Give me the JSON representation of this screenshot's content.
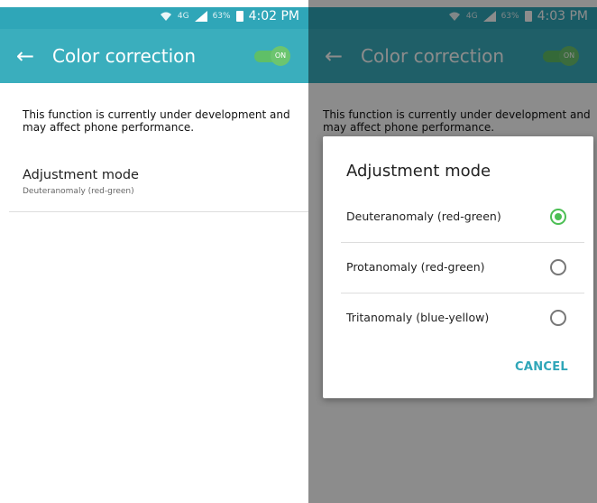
{
  "left": {
    "status": {
      "wifi_label": "4G",
      "battery": "63%",
      "time": "4:02 PM"
    },
    "appbar": {
      "back": "←",
      "title": "Color correction",
      "toggle": "ON"
    },
    "warning": "This function is currently under development and may affect phone performance.",
    "adjustment": {
      "title": "Adjustment mode",
      "value": "Deuteranomaly (red-green)"
    }
  },
  "right": {
    "status": {
      "wifi_label": "4G",
      "battery": "63%",
      "time": "4:03 PM"
    },
    "appbar": {
      "back": "←",
      "title": "Color correction",
      "toggle": "ON"
    },
    "warning": "This function is currently under development and may affect phone performance.",
    "dialog": {
      "title": "Adjustment mode",
      "options": [
        {
          "label": "Deuteranomaly (red-green)"
        },
        {
          "label": "Protanomaly (red-green)"
        },
        {
          "label": "Tritanomaly (blue-yellow)"
        }
      ],
      "selected": "Deuteranomaly (red-green)",
      "cancel": "CANCEL"
    }
  },
  "colors": {
    "appbar": "#3aaebd",
    "accent": "#4cbf54",
    "cancel": "#2fa6b8"
  }
}
